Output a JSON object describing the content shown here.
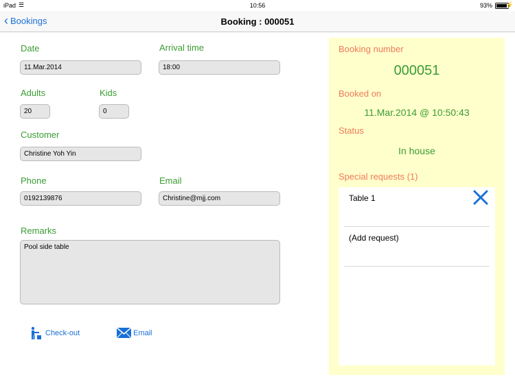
{
  "status_bar": {
    "carrier": "iPad",
    "time": "10:56",
    "battery": "93%",
    "battery_level": 0.93
  },
  "nav": {
    "back_label": "Bookings",
    "title": "Booking : 000051"
  },
  "form": {
    "date_label": "Date",
    "date_value": "11.Mar.2014",
    "arrival_label": "Arrival time",
    "arrival_value": "18:00",
    "adults_label": "Adults",
    "adults_value": "20",
    "kids_label": "Kids",
    "kids_value": "0",
    "customer_label": "Customer",
    "customer_value": "Christine Yoh Yin",
    "phone_label": "Phone",
    "phone_value": "0192139876",
    "email_label": "Email",
    "email_value": "Christine@mjj.com",
    "remarks_label": "Remarks",
    "remarks_value": "Pool side table"
  },
  "actions": {
    "checkout_label": "Check-out",
    "email_label": "Email"
  },
  "panel": {
    "booking_number_label": "Booking number",
    "booking_number": "000051",
    "booked_on_label": "Booked on",
    "booked_on": "11.Mar.2014 @ 10:50:43",
    "status_label": "Status",
    "status": "In house",
    "requests_label": "Special requests (1)",
    "requests": [
      {
        "text": "Table 1"
      },
      {
        "text": "(Add request)"
      }
    ]
  },
  "colors": {
    "accent": "#1a6fd6",
    "label_green": "#3a9c33",
    "label_orange": "#ee7a5a",
    "panel_bg": "#ffffcc"
  }
}
